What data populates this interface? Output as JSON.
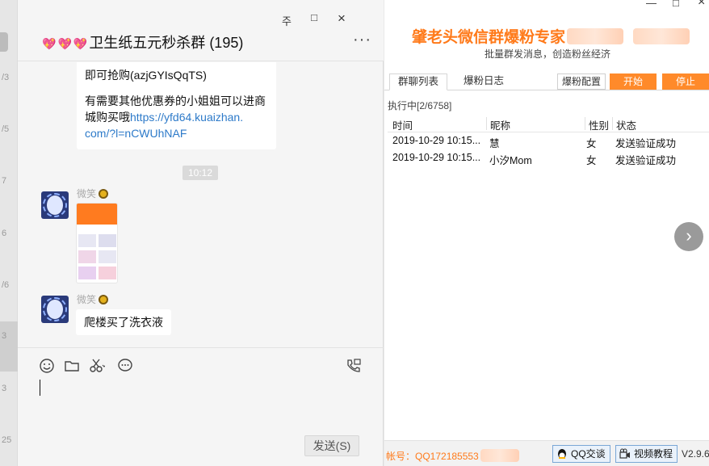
{
  "left_sliver": {
    "numbers": [
      "/3",
      "/5",
      "7",
      "6",
      "/6",
      "3",
      "3",
      "25"
    ]
  },
  "chat": {
    "title": "卫生纸五元秒杀群 (195)",
    "more_label": "···",
    "window_buttons": {
      "pin": "주",
      "restore": "□",
      "close": "×"
    },
    "messages": {
      "text_block_line1": "即可抢购(azjGYIsQqTS)",
      "text_block_line2": "有需要其他优惠券的小姐姐可以进商",
      "text_block_line3_prefix": "城购买哦",
      "text_block_link1": "https://yfd64.kuaizhan.",
      "text_block_link2": "com/?l=nCWUhNAF",
      "time_chip": "10:12",
      "sender1": "微笑",
      "sender2": "微笑",
      "message2": "爬楼买了洗衣液"
    },
    "send_label": "发送(S)"
  },
  "tool": {
    "title": "肈老头微信群爆粉专家",
    "subtitle": "批量群发消息，创造粉丝经济",
    "window_buttons": {
      "minimize": "—",
      "maximize": "□",
      "close": "×"
    },
    "tabs": [
      "群聊列表",
      "爆粉日志"
    ],
    "config_label": "爆粉配置",
    "start_label": "开始",
    "stop_label": "停止",
    "exec_status": "执行中[2/6758]",
    "columns": [
      "时间",
      "昵称",
      "性别",
      "状态"
    ],
    "rows": [
      {
        "time": "2019-10-29 10:15...",
        "nick": "慧",
        "gender": "女",
        "status": "发送验证成功"
      },
      {
        "time": "2019-10-29 10:15...",
        "nick": "小汐Mom",
        "gender": "女",
        "status": "发送验证成功"
      }
    ],
    "next_label": "›",
    "account": "帐号：QQ172185553",
    "qq_label": "QQ交谈",
    "video_label": "视频教程",
    "version": "V2.9.6"
  }
}
